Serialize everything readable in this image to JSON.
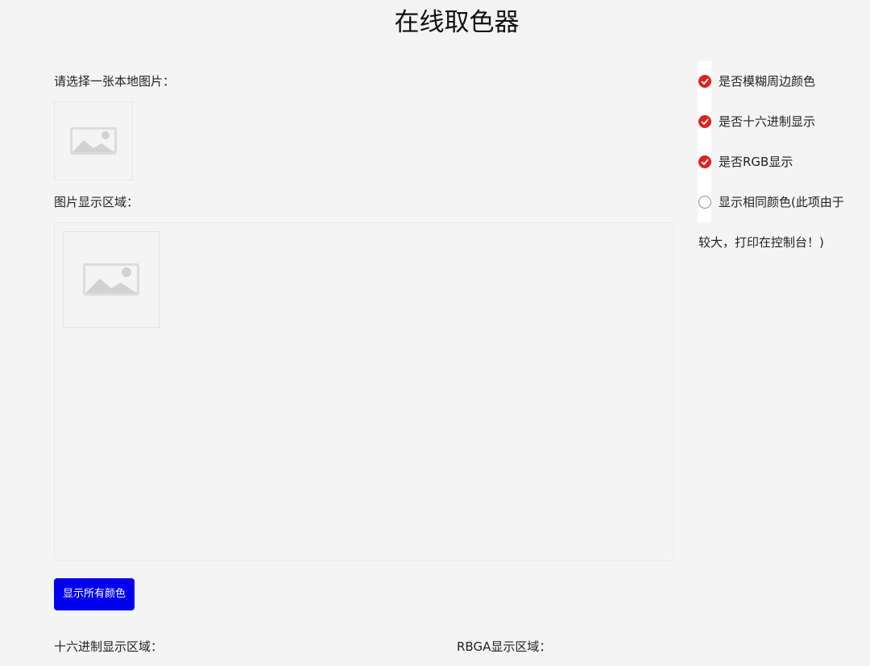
{
  "page": {
    "title": "在线取色器"
  },
  "upload": {
    "label": "请选择一张本地图片：",
    "icon": "image-placeholder-icon"
  },
  "display": {
    "label": "图片显示区域：",
    "icon": "image-placeholder-icon"
  },
  "actions": {
    "show_all_colors": "显示所有颜色"
  },
  "options": [
    {
      "label": "是否模糊周边颜色",
      "checked": true
    },
    {
      "label": "是否十六进制显示",
      "checked": true
    },
    {
      "label": "是否RGB显示",
      "checked": true
    },
    {
      "label": "显示相同颜色(此项由于",
      "checked": false
    }
  ],
  "options_note": "较大，打印在控制台！)",
  "output": {
    "hex_label": "十六进制显示区域：",
    "rgba_label": "RBGA显示区域："
  },
  "colors": {
    "accent_button": "#0000ee",
    "checked_radio": "#dd2222"
  }
}
